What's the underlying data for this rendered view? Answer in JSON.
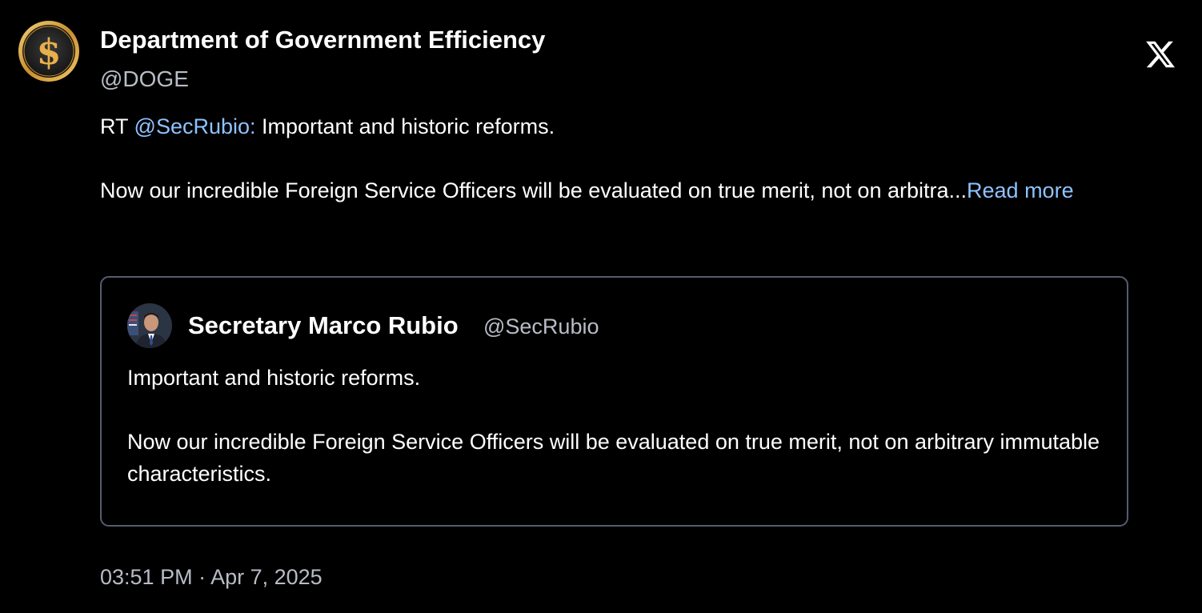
{
  "author": {
    "display_name": "Department of Government Efficiency",
    "handle": "@DOGE",
    "avatar_icon": "dollar-coin-icon"
  },
  "brand_icon": "x-logo-icon",
  "post": {
    "prefix": "RT ",
    "mention": "@SecRubio:",
    "line1_rest": " Important and historic reforms.",
    "line2": "Now our incredible Foreign Service Officers will be evaluated on true merit, not on arbitra...",
    "read_more": "Read more"
  },
  "quoted": {
    "display_name": "Secretary Marco Rubio",
    "handle": "@SecRubio",
    "avatar_icon": "portrait-avatar-icon",
    "paragraph1": "Important and historic reforms.",
    "paragraph2": "Now our incredible Foreign Service Officers will be evaluated on true merit, not on arbitrary immutable characteristics."
  },
  "timestamp": "03:51 PM · Apr 7, 2025",
  "colors": {
    "background": "#000000",
    "text": "#ffffff",
    "secondary_text": "#b8bcc6",
    "link": "#8ec2ff",
    "card_border": "#565b6e",
    "coin_gold": "#d9a23c"
  }
}
